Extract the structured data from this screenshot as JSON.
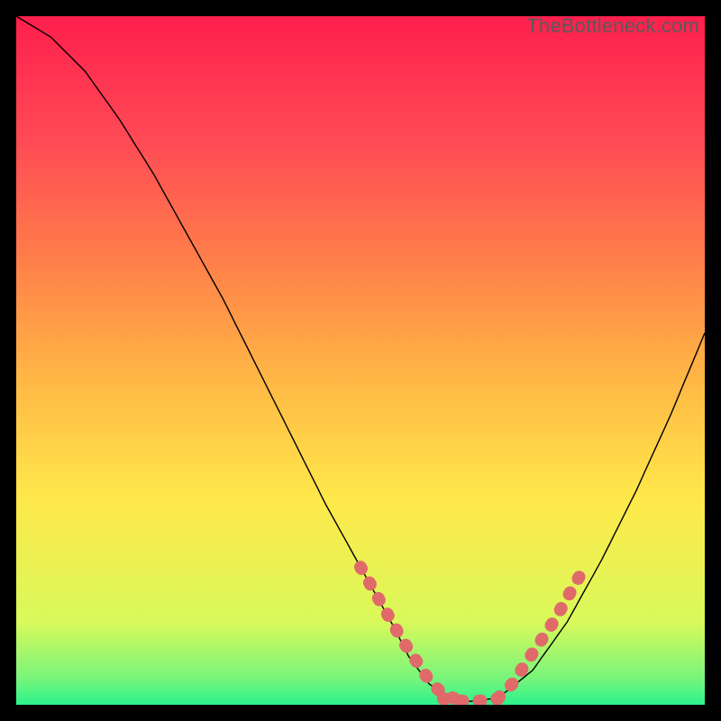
{
  "watermark": "TheBottleneck.com",
  "chart_data": {
    "type": "line",
    "title": "",
    "xlabel": "",
    "ylabel": "",
    "xlim": [
      0,
      100
    ],
    "ylim": [
      0,
      100
    ],
    "series": [
      {
        "name": "main-curve",
        "x": [
          0,
          5,
          10,
          15,
          20,
          25,
          30,
          35,
          40,
          45,
          50,
          55,
          57,
          60,
          63,
          66,
          70,
          75,
          80,
          85,
          90,
          95,
          100
        ],
        "y": [
          100,
          97,
          92,
          85,
          77,
          68,
          59,
          49,
          39,
          29,
          20,
          11,
          7,
          3,
          1,
          0.5,
          1,
          5,
          12,
          21,
          31,
          42,
          54
        ]
      },
      {
        "name": "highlight-left",
        "x": [
          50,
          52,
          54,
          56,
          58,
          60,
          62,
          64
        ],
        "y": [
          20,
          16.5,
          13,
          9.5,
          6.5,
          3.5,
          1.5,
          0.8
        ]
      },
      {
        "name": "highlight-right",
        "x": [
          70,
          72,
          74,
          76,
          78,
          80,
          82
        ],
        "y": [
          1,
          3,
          6,
          9,
          12,
          15.5,
          19
        ]
      }
    ]
  }
}
